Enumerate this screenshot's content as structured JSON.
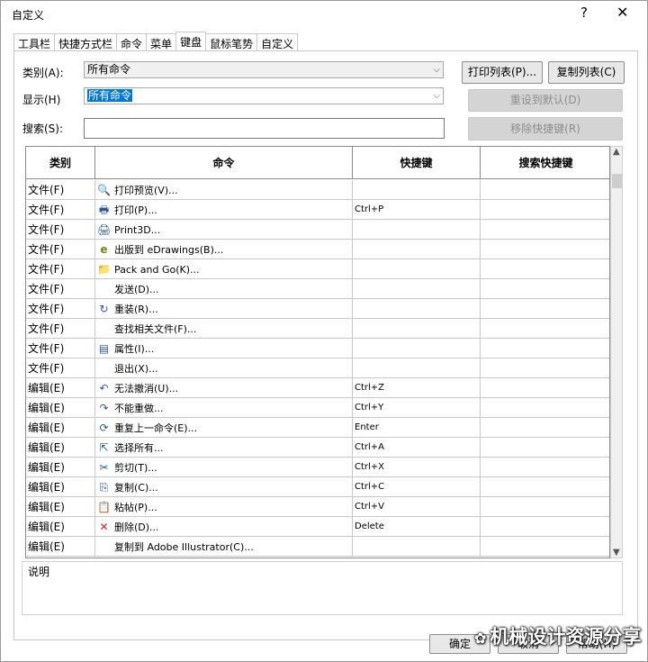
{
  "window": {
    "title": "自定义",
    "help_glyph": "?",
    "close_glyph": "✕"
  },
  "tabs": [
    "工具栏",
    "快捷方式栏",
    "命令",
    "菜单",
    "键盘",
    "鼠标笔势",
    "自定义"
  ],
  "active_tab": "键盘",
  "form": {
    "category_label": "类别(A):",
    "category_value": "所有命令",
    "display_label": "显示(H)",
    "display_value": "所有命令",
    "search_label": "搜索(S):",
    "search_value": ""
  },
  "buttons": {
    "print_list": "打印列表(P)...",
    "copy_list": "复制列表(C)",
    "reset_default": "重设到默认(D)",
    "remove_shortcut": "移除快捷键(R)",
    "ok": "确定",
    "cancel": "取消",
    "help": "帮助(H)"
  },
  "table": {
    "columns": [
      "类别",
      "命令",
      "快捷键",
      "搜索快捷键"
    ],
    "rows": [
      {
        "cat": "文件(F)",
        "icon": "print-preview-icon",
        "cmd": "打印预览(V)...",
        "key": ""
      },
      {
        "cat": "文件(F)",
        "icon": "printer-icon",
        "cmd": "打印(P)...",
        "key": "Ctrl+P"
      },
      {
        "cat": "文件(F)",
        "icon": "print3d-icon",
        "cmd": "Print3D...",
        "key": ""
      },
      {
        "cat": "文件(F)",
        "icon": "edrawings-icon",
        "cmd": "出版到 eDrawings(B)...",
        "key": ""
      },
      {
        "cat": "文件(F)",
        "icon": "pack-and-go-icon",
        "cmd": "Pack and Go(K)...",
        "key": ""
      },
      {
        "cat": "文件(F)",
        "icon": "",
        "cmd": "发送(D)...",
        "key": ""
      },
      {
        "cat": "文件(F)",
        "icon": "reload-icon",
        "cmd": "重装(R)...",
        "key": ""
      },
      {
        "cat": "文件(F)",
        "icon": "",
        "cmd": "查找相关文件(F)...",
        "key": ""
      },
      {
        "cat": "文件(F)",
        "icon": "properties-icon",
        "cmd": "属性(I)...",
        "key": ""
      },
      {
        "cat": "文件(F)",
        "icon": "",
        "cmd": "退出(X)...",
        "key": ""
      },
      {
        "cat": "编辑(E)",
        "icon": "undo-icon",
        "cmd": "无法撤消(U)...",
        "key": "Ctrl+Z"
      },
      {
        "cat": "编辑(E)",
        "icon": "redo-icon",
        "cmd": "不能重做...",
        "key": "Ctrl+Y"
      },
      {
        "cat": "编辑(E)",
        "icon": "repeat-icon",
        "cmd": "重复上一命令(E)...",
        "key": "Enter"
      },
      {
        "cat": "编辑(E)",
        "icon": "select-all-icon",
        "cmd": "选择所有...",
        "key": "Ctrl+A"
      },
      {
        "cat": "编辑(E)",
        "icon": "scissors-icon",
        "cmd": "剪切(T)...",
        "key": "Ctrl+X"
      },
      {
        "cat": "编辑(E)",
        "icon": "copy-icon",
        "cmd": "复制(C)...",
        "key": "Ctrl+C"
      },
      {
        "cat": "编辑(E)",
        "icon": "paste-icon",
        "cmd": "粘帖(P)...",
        "key": "Ctrl+V"
      },
      {
        "cat": "编辑(E)",
        "icon": "delete-icon",
        "cmd": "删除(D)...",
        "key": "Delete"
      },
      {
        "cat": "编辑(E)",
        "icon": "",
        "cmd": "复制到 Adobe Illustrator(C)...",
        "key": ""
      }
    ]
  },
  "description_label": "说明",
  "watermark": "机械设计资源分享",
  "icon_glyphs": {
    "print-preview-icon": "🔍",
    "printer-icon": "🖶",
    "print3d-icon": "🖨",
    "edrawings-icon": "e",
    "pack-and-go-icon": "📁",
    "reload-icon": "↻",
    "properties-icon": "▤",
    "undo-icon": "↶",
    "redo-icon": "↷",
    "repeat-icon": "⟳",
    "select-all-icon": "⇱",
    "scissors-icon": "✂",
    "copy-icon": "⎘",
    "paste-icon": "📋",
    "delete-icon": "✕"
  }
}
